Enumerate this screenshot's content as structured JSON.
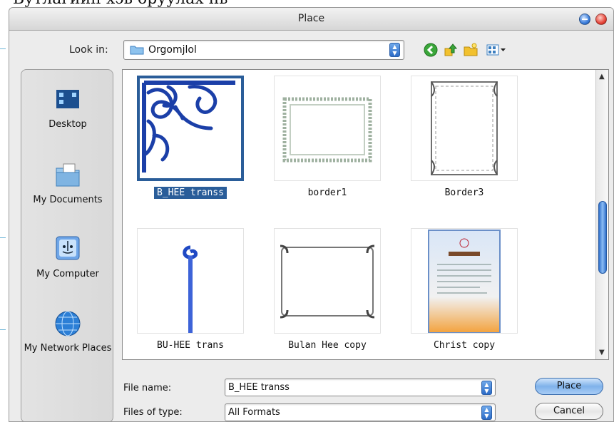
{
  "background": {
    "top_text": "Бутлагиин хэв оруулах нь"
  },
  "window": {
    "title": "Place"
  },
  "look_in": {
    "label": "Look in:",
    "value": "Orgomjlol"
  },
  "sidebar": {
    "items": [
      {
        "label": "Desktop",
        "icon": "desktop-icon"
      },
      {
        "label": "My Documents",
        "icon": "my-documents-icon"
      },
      {
        "label": "My Computer",
        "icon": "my-computer-icon"
      },
      {
        "label": "My Network Places",
        "icon": "network-places-icon"
      }
    ]
  },
  "files": [
    {
      "name": "B_HEE transs",
      "selected": true
    },
    {
      "name": "border1",
      "selected": false
    },
    {
      "name": "Border3",
      "selected": false
    },
    {
      "name": "BU-HEE trans",
      "selected": false
    },
    {
      "name": "Bulan Hee copy",
      "selected": false
    },
    {
      "name": "Christ copy",
      "selected": false
    }
  ],
  "file_name": {
    "label": "File name:",
    "value": "B_HEE transs"
  },
  "file_type": {
    "label": "Files of type:",
    "value": "All Formats"
  },
  "buttons": {
    "place": "Place",
    "cancel": "Cancel"
  },
  "colors": {
    "accent": "#2a5d99",
    "aqua": "#3b7ddb",
    "close": "#e6453a"
  }
}
